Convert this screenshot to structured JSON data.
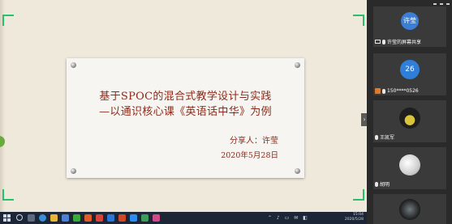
{
  "slide": {
    "title_line1": "基于SPOC的混合式教学设计与实践",
    "title_line2": "—以通识核心课《英语话中华》为例",
    "sharer": "分享人：许莹",
    "date": "2020年5月28日"
  },
  "participants": [
    {
      "avatar_text": "许莹",
      "caption": "许莹的屏幕共享",
      "avatar_color": "#3a7fd5"
    },
    {
      "avatar_text": "26",
      "caption": "150****0526",
      "avatar_color": "#2f7fd9"
    },
    {
      "avatar_text": "",
      "caption": "王凯军",
      "avatar_color": "#1f1f1f"
    },
    {
      "avatar_text": "",
      "caption": "胡明",
      "avatar_color": "#dcdcdc"
    },
    {
      "avatar_text": "",
      "caption": "",
      "avatar_color": "#1b1b1b"
    }
  ],
  "taskbar": {
    "time": "15:04",
    "date": "2020/5/28"
  },
  "colors": {
    "slide_text": "#8b2a1a",
    "share_border": "#27c06b"
  }
}
